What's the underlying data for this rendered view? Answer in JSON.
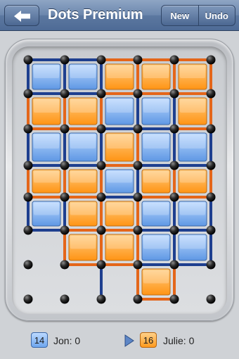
{
  "navbar": {
    "back_icon": "back-arrow-icon",
    "title": "Dots Premium",
    "new_label": "New",
    "undo_label": "Undo"
  },
  "colors": {
    "blue_box": "#6ea6ee",
    "orange_box": "#ff9a1e",
    "blue_line": "#1e3f8f",
    "orange_line": "#e4661a"
  },
  "board": {
    "dots_cols": 6,
    "dots_rows": 8,
    "boxes": [
      [
        "B",
        "B",
        "O",
        "O",
        "O"
      ],
      [
        "O",
        "O",
        "B",
        "B",
        "O"
      ],
      [
        "B",
        "B",
        "O",
        "B",
        "B"
      ],
      [
        "O",
        "O",
        "B",
        "O",
        "O"
      ],
      [
        "B",
        "O",
        "O",
        "B",
        "B"
      ],
      [
        null,
        "O",
        "O",
        "B",
        "B"
      ],
      [
        null,
        null,
        null,
        "O",
        null
      ]
    ]
  },
  "players": [
    {
      "score": "14",
      "label": "Jon: 0",
      "color": "blue"
    },
    {
      "score": "16",
      "label": "Julie: 0",
      "color": "orange"
    }
  ],
  "current_turn": 1
}
